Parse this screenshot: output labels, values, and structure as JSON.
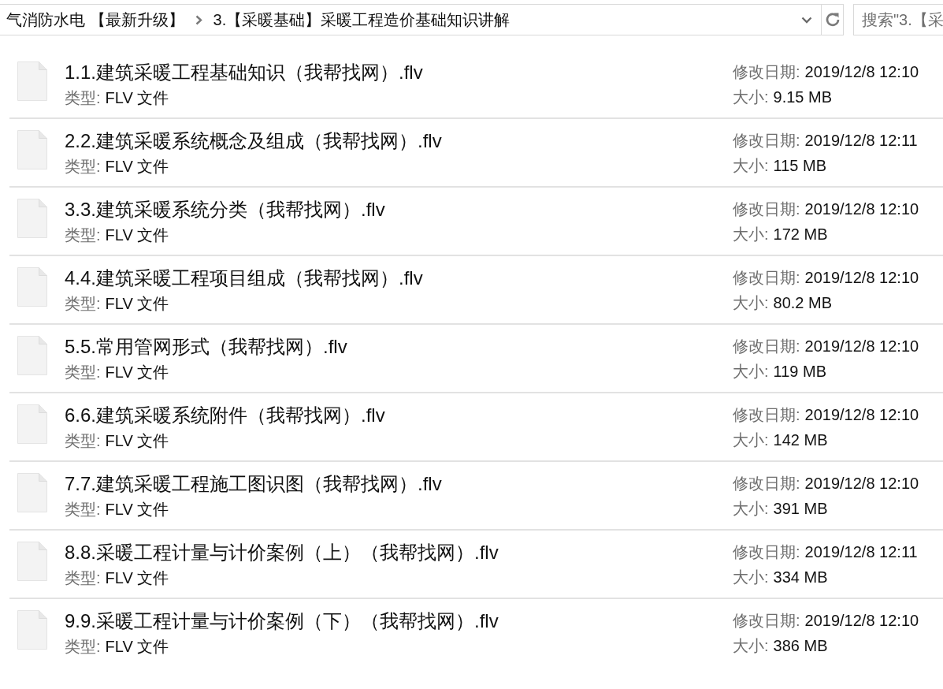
{
  "address_bar": {
    "breadcrumbs": [
      {
        "label": "气消防水电 【最新升级】"
      },
      {
        "label": "3.【采暖基础】采暖工程造价基础知识讲解"
      }
    ]
  },
  "search": {
    "placeholder": "搜索\"3.【采"
  },
  "files": [
    {
      "name": "1.1.建筑采暖工程基础知识（我帮找网）.flv",
      "type_label": "类型:",
      "type": "FLV 文件",
      "date_label": "修改日期:",
      "date": "2019/12/8 12:10",
      "size_label": "大小:",
      "size": "9.15 MB"
    },
    {
      "name": "2.2.建筑采暖系统概念及组成（我帮找网）.flv",
      "type_label": "类型:",
      "type": "FLV 文件",
      "date_label": "修改日期:",
      "date": "2019/12/8 12:11",
      "size_label": "大小:",
      "size": "115 MB"
    },
    {
      "name": "3.3.建筑采暖系统分类（我帮找网）.flv",
      "type_label": "类型:",
      "type": "FLV 文件",
      "date_label": "修改日期:",
      "date": "2019/12/8 12:10",
      "size_label": "大小:",
      "size": "172 MB"
    },
    {
      "name": "4.4.建筑采暖工程项目组成（我帮找网）.flv",
      "type_label": "类型:",
      "type": "FLV 文件",
      "date_label": "修改日期:",
      "date": "2019/12/8 12:10",
      "size_label": "大小:",
      "size": "80.2 MB"
    },
    {
      "name": "5.5.常用管网形式（我帮找网）.flv",
      "type_label": "类型:",
      "type": "FLV 文件",
      "date_label": "修改日期:",
      "date": "2019/12/8 12:10",
      "size_label": "大小:",
      "size": "119 MB"
    },
    {
      "name": "6.6.建筑采暖系统附件（我帮找网）.flv",
      "type_label": "类型:",
      "type": "FLV 文件",
      "date_label": "修改日期:",
      "date": "2019/12/8 12:10",
      "size_label": "大小:",
      "size": "142 MB"
    },
    {
      "name": "7.7.建筑采暖工程施工图识图（我帮找网）.flv",
      "type_label": "类型:",
      "type": "FLV 文件",
      "date_label": "修改日期:",
      "date": "2019/12/8 12:10",
      "size_label": "大小:",
      "size": "391 MB"
    },
    {
      "name": "8.8.采暖工程计量与计价案例（上）（我帮找网）.flv",
      "type_label": "类型:",
      "type": "FLV 文件",
      "date_label": "修改日期:",
      "date": "2019/12/8 12:11",
      "size_label": "大小:",
      "size": "334 MB"
    },
    {
      "name": "9.9.采暖工程计量与计价案例（下）（我帮找网）.flv",
      "type_label": "类型:",
      "type": "FLV 文件",
      "date_label": "修改日期:",
      "date": "2019/12/8 12:10",
      "size_label": "大小:",
      "size": "386 MB"
    }
  ]
}
